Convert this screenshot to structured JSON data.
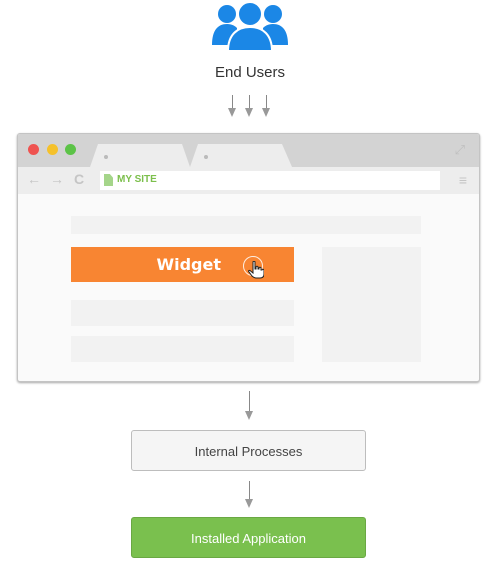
{
  "top": {
    "icon": "users-group-icon",
    "label": "End Users",
    "icon_color": "#1b87e6"
  },
  "browser": {
    "window_controls": [
      {
        "name": "close",
        "color": "#ef5350"
      },
      {
        "name": "minimize",
        "color": "#f5c12b"
      },
      {
        "name": "maximize",
        "color": "#5cc347"
      }
    ],
    "tabs": 2,
    "nav_icons": [
      "back-arrow-icon",
      "forward-arrow-icon",
      "reload-icon"
    ],
    "url_text": "MY SITE",
    "url_color": "#7cbf4c",
    "widget": {
      "label": "Widget",
      "color": "#f88532"
    }
  },
  "steps": [
    {
      "label": "Internal Processes",
      "color": "#f5f5f5"
    },
    {
      "label": "Installed Application",
      "color": "#7ac04e"
    }
  ]
}
